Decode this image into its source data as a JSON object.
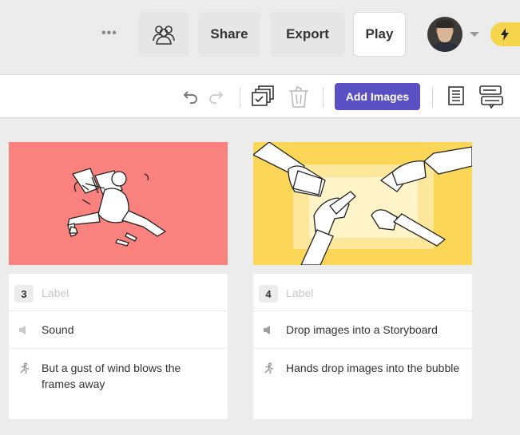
{
  "header": {
    "more_label": "•••",
    "collaborators_icon": "people-icon",
    "share_label": "Share",
    "export_label": "Export",
    "play_label": "Play",
    "avatar_icon": "user-avatar",
    "dropdown_icon": "chevron-down-icon",
    "bolt_icon": "lightning-bolt-icon"
  },
  "toolbar": {
    "undo_icon": "undo-icon",
    "redo_icon": "redo-icon",
    "duplicate_icon": "duplicate-frames-icon",
    "trash_icon": "trash-icon",
    "add_images_label": "Add Images",
    "script_view_icon": "document-icon",
    "comments_icon": "comments-icon",
    "accent_color": "#5b4fc4"
  },
  "frames": [
    {
      "number": "3",
      "image_color": "#f9817e",
      "label_placeholder": "Label",
      "sound_placeholder": "Sound",
      "sound_text": "",
      "action_text": "But a gust of wind blows the frames away"
    },
    {
      "number": "4",
      "image_color": "#fbd657",
      "label_placeholder": "Label",
      "sound_placeholder": "",
      "sound_text": "Drop images into a Storyboard",
      "action_text": "Hands drop images into the bubble"
    }
  ]
}
